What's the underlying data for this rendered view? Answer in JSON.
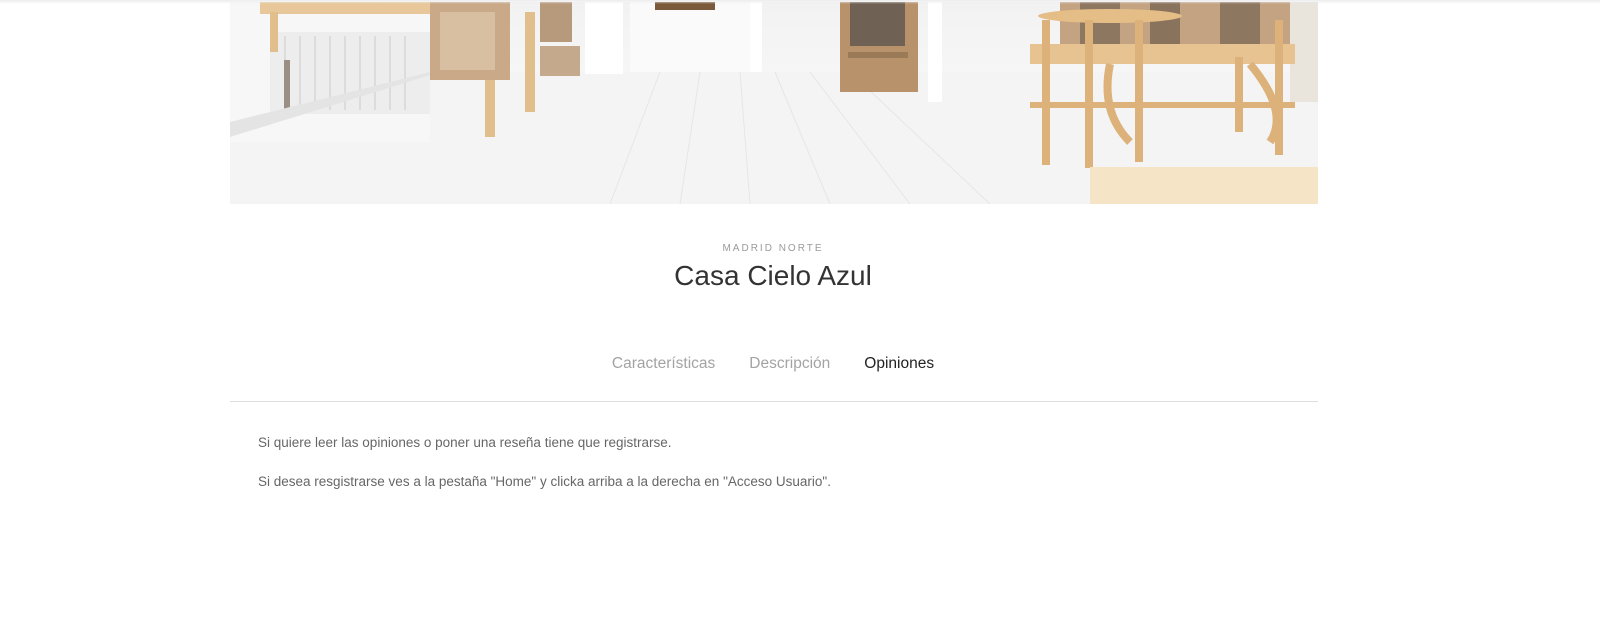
{
  "listing": {
    "location": "MADRID NORTE",
    "title": "Casa Cielo Azul"
  },
  "tabs": [
    {
      "label": "Características",
      "active": false
    },
    {
      "label": "Descripción",
      "active": false
    },
    {
      "label": "Opiniones",
      "active": true
    }
  ],
  "reviews_panel": {
    "message_1": "Si quiere leer las opiniones o poner una reseña tiene que registrarse.",
    "message_2": "Si desea resgistrarse ves a la pestaña \"Home\" y clicka arriba a la derecha en \"Acceso Usuario\"."
  },
  "colors": {
    "tab_active": "#222222",
    "tab_inactive": "#a3a3a3",
    "body_text": "#666666",
    "divider": "#dedede"
  }
}
